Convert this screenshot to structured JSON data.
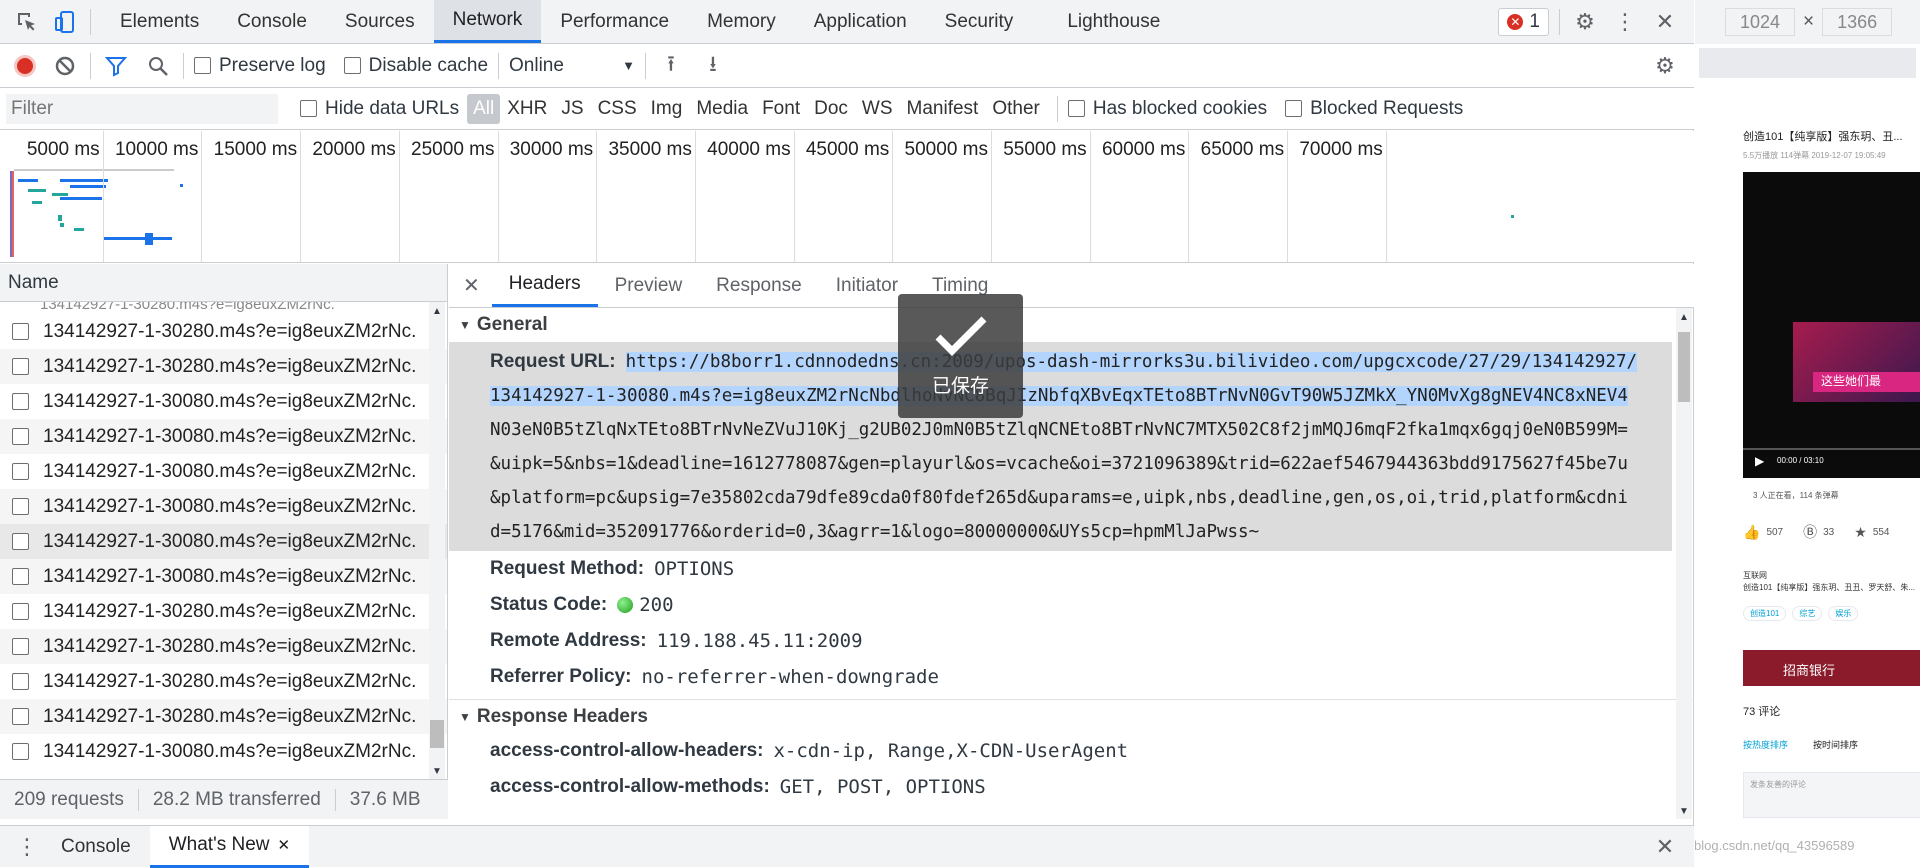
{
  "toolbar": {
    "tabs": [
      "Elements",
      "Console",
      "Sources",
      "Network",
      "Performance",
      "Memory",
      "Application",
      "Security",
      "Lighthouse"
    ],
    "error_count": "1"
  },
  "network_toolbar": {
    "preserve_log": "Preserve log",
    "disable_cache": "Disable cache",
    "throttle": "Online"
  },
  "filter_bar": {
    "placeholder": "Filter",
    "hide_data_urls": "Hide data URLs",
    "types": [
      "All",
      "XHR",
      "JS",
      "CSS",
      "Img",
      "Media",
      "Font",
      "Doc",
      "WS",
      "Manifest",
      "Other"
    ],
    "has_blocked_cookies": "Has blocked cookies",
    "blocked_requests": "Blocked Requests"
  },
  "timeline": {
    "ticks": [
      "5000 ms",
      "10000 ms",
      "15000 ms",
      "20000 ms",
      "25000 ms",
      "30000 ms",
      "35000 ms",
      "40000 ms",
      "45000 ms",
      "50000 ms",
      "55000 ms",
      "60000 ms",
      "65000 ms",
      "70000 ms"
    ]
  },
  "request_list": {
    "header": "Name",
    "rows": [
      "134142927-1-30280.m4s?e=ig8euxZM2rNc.",
      "134142927-1-30280.m4s?e=ig8euxZM2rNc.",
      "134142927-1-30080.m4s?e=ig8euxZM2rNc.",
      "134142927-1-30080.m4s?e=ig8euxZM2rNc.",
      "134142927-1-30080.m4s?e=ig8euxZM2rNc.",
      "134142927-1-30080.m4s?e=ig8euxZM2rNc.",
      "134142927-1-30080.m4s?e=ig8euxZM2rNc.",
      "134142927-1-30080.m4s?e=ig8euxZM2rNc.",
      "134142927-1-30280.m4s?e=ig8euxZM2rNc.",
      "134142927-1-30280.m4s?e=ig8euxZM2rNc.",
      "134142927-1-30280.m4s?e=ig8euxZM2rNc.",
      "134142927-1-30280.m4s?e=ig8euxZM2rNc.",
      "134142927-1-30080.m4s?e=ig8euxZM2rNc."
    ]
  },
  "status": {
    "requests": "209 requests",
    "transferred": "28.2 MB transferred",
    "resources": "37.6 MB"
  },
  "detail_tabs": [
    "Headers",
    "Preview",
    "Response",
    "Initiator",
    "Timing"
  ],
  "general": {
    "title": "General",
    "request_url_label": "Request URL:",
    "request_url_lines": [
      "https://b8borr1.cdnnodedns.cn:2009/upos-dash-mirrorks3u.bilivideo.com/upgcxcode/27/29/134142927/",
      "134142927-1-30080.m4s?e=ig8euxZM2rNcNbdlhoNvNC8BqJIzNbfqXBvEqxTEto8BTrNvN0GvT90W5JZMkX_YN0MvXg8gNEV4NC8xNEV4",
      "N03eN0B5tZlqNxTEto8BTrNvNeZVuJ10Kj_g2UB02J0mN0B5tZlqNCNEto8BTrNvNC7MTX502C8f2jmMQJ6mqF2fka1mqx6gqj0eN0B599M=",
      "&uipk=5&nbs=1&deadline=1612778087&gen=playurl&os=vcache&oi=3721096389&trid=622aef5467944363bdd9175627f45be7u",
      "&platform=pc&upsig=7e35802cda79dfe89cda0f80fdef265d&uparams=e,uipk,nbs,deadline,gen,os,oi,trid,platform&cdni",
      "d=5176&mid=352091776&orderid=0,3&agrr=1&logo=80000000&UYs5cp=hpmMlJaPwss~"
    ],
    "method_label": "Request Method:",
    "method": "OPTIONS",
    "status_label": "Status Code:",
    "status": "200",
    "remote_label": "Remote Address:",
    "remote": "119.188.45.11:2009",
    "referrer_label": "Referrer Policy:",
    "referrer": "no-referrer-when-downgrade"
  },
  "response_headers": {
    "title": "Response Headers",
    "h1_label": "access-control-allow-headers:",
    "h1": "x-cdn-ip, Range,X-CDN-UserAgent",
    "h2_label": "access-control-allow-methods:",
    "h2": "GET, POST, OPTIONS"
  },
  "toast": "已保存",
  "drawer": {
    "console": "Console",
    "whats_new": "What's New"
  },
  "device": {
    "width": "1024",
    "height": "1366"
  },
  "page_preview": {
    "video_title": "创造101【纯享版】强东玥、丑...",
    "meta": "5.5万播放  114弹幕  2019-12-07 19:05:49",
    "time": "00:00 / 03:10",
    "viewers": "3 人正在看，114 条弹幕",
    "likes": "507",
    "coins": "33",
    "favs": "554",
    "category": "互联网",
    "desc": "创造101【纯享版】强东玥、丑丑、罗天舒、朱...",
    "tags": [
      "创造101",
      "综艺",
      "娱乐"
    ],
    "ad": "招商银行",
    "comments": "73  评论",
    "sort_hot": "按热度排序",
    "sort_time": "按时间排序",
    "comment_placeholder": "发条友善的评论",
    "watermark": "https://blog.csdn.net/qq_43596589"
  }
}
